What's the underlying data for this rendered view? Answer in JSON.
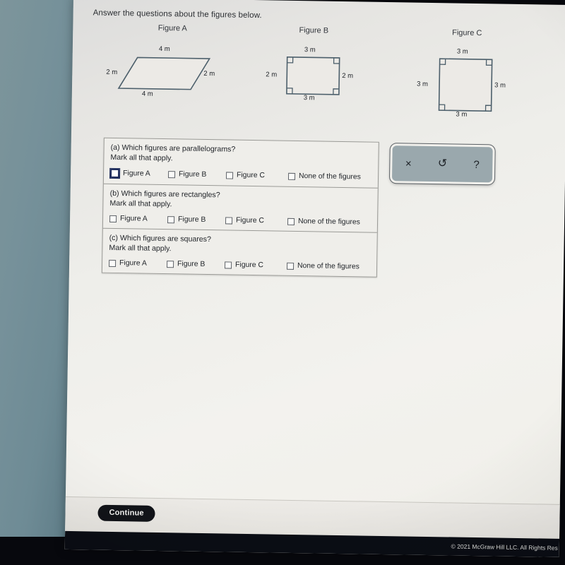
{
  "prompt": "Answer the questions about the figures below.",
  "figures": [
    {
      "title": "Figure A",
      "shape": "parallelogram",
      "dims": {
        "top": "4 m",
        "bottom": "4 m",
        "left": "2 m",
        "right": "2 m"
      }
    },
    {
      "title": "Figure B",
      "shape": "rectangle",
      "dims": {
        "top": "3 m",
        "bottom": "3 m",
        "left": "2 m",
        "right": "2 m"
      }
    },
    {
      "title": "Figure C",
      "shape": "square",
      "dims": {
        "top": "3 m",
        "bottom": "3 m",
        "left": "3 m",
        "right": "3 m"
      }
    }
  ],
  "questions": [
    {
      "label": "(a) Which figures are parallelograms?",
      "instruction": "Mark all that apply.",
      "options": [
        {
          "label": "Figure A",
          "checked": false,
          "focused": true
        },
        {
          "label": "Figure B",
          "checked": false,
          "focused": false
        },
        {
          "label": "Figure C",
          "checked": false,
          "focused": false
        },
        {
          "label": "None of the figures",
          "checked": false,
          "focused": false
        }
      ]
    },
    {
      "label": "(b) Which figures are rectangles?",
      "instruction": "Mark all that apply.",
      "options": [
        {
          "label": "Figure A",
          "checked": false,
          "focused": false
        },
        {
          "label": "Figure B",
          "checked": false,
          "focused": false
        },
        {
          "label": "Figure C",
          "checked": false,
          "focused": false
        },
        {
          "label": "None of the figures",
          "checked": false,
          "focused": false
        }
      ]
    },
    {
      "label": "(c) Which figures are squares?",
      "instruction": "Mark all that apply.",
      "options": [
        {
          "label": "Figure A",
          "checked": false,
          "focused": false
        },
        {
          "label": "Figure B",
          "checked": false,
          "focused": false
        },
        {
          "label": "Figure C",
          "checked": false,
          "focused": false
        },
        {
          "label": "None of the figures",
          "checked": false,
          "focused": false
        }
      ]
    }
  ],
  "toolbar": {
    "clear_label": "×",
    "undo_label": "↺",
    "help_label": "?"
  },
  "footer": {
    "continue_label": "Continue",
    "copyright": "© 2021 McGraw Hill LLC. All Rights Res"
  },
  "colors": {
    "shape_stroke": "#4c5f6b",
    "focus_outline": "#1e2c5c",
    "continue_bg": "#111318",
    "page_bg": "#efeeea"
  }
}
